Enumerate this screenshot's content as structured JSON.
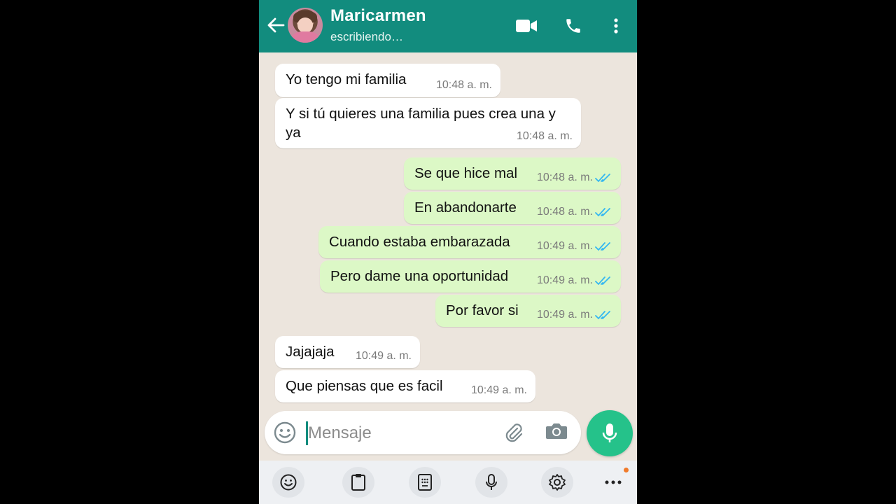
{
  "header": {
    "contact_name": "Maricarmen",
    "status": "escribiendo…",
    "color": "#128c7e"
  },
  "messages": [
    {
      "direction": "in",
      "text": "Yo tengo mi familia",
      "time": "10:48 a. m."
    },
    {
      "direction": "in",
      "text": "Y si tú quieres una familia pues crea una y ya",
      "time": "10:48 a. m."
    },
    {
      "direction": "out",
      "text": "Se que hice mal",
      "time": "10:48 a. m.",
      "status": "read"
    },
    {
      "direction": "out",
      "text": "En abandonarte",
      "time": "10:48 a. m.",
      "status": "read"
    },
    {
      "direction": "out",
      "text": "Cuando estaba embarazada",
      "time": "10:49 a. m.",
      "status": "read"
    },
    {
      "direction": "out",
      "text": "Pero dame una oportunidad",
      "time": "10:49 a. m.",
      "status": "read"
    },
    {
      "direction": "out",
      "text": "Por favor si",
      "time": "10:49 a. m.",
      "status": "read"
    },
    {
      "direction": "in",
      "text": "Jajajaja",
      "time": "10:49 a. m."
    },
    {
      "direction": "in",
      "text": "Que piensas que es facil",
      "time": "10:49 a. m."
    }
  ],
  "composer": {
    "placeholder": "Mensaje",
    "value": ""
  },
  "icons": {
    "header": [
      "back-arrow-icon",
      "video-call-icon",
      "phone-icon",
      "more-vert-icon"
    ],
    "composer": [
      "emoji-icon",
      "attach-icon",
      "camera-icon",
      "mic-icon"
    ],
    "keyboard": [
      "emoji-icon",
      "clipboard-icon",
      "keypad-icon",
      "mic-icon",
      "settings-icon",
      "more-horiz-icon"
    ]
  },
  "colors": {
    "outgoing_bubble": "#dcf8c6",
    "incoming_bubble": "#ffffff",
    "read_ticks": "#34b7f1",
    "mic_button": "#25c28a",
    "notification_dot": "#f07a2a"
  }
}
